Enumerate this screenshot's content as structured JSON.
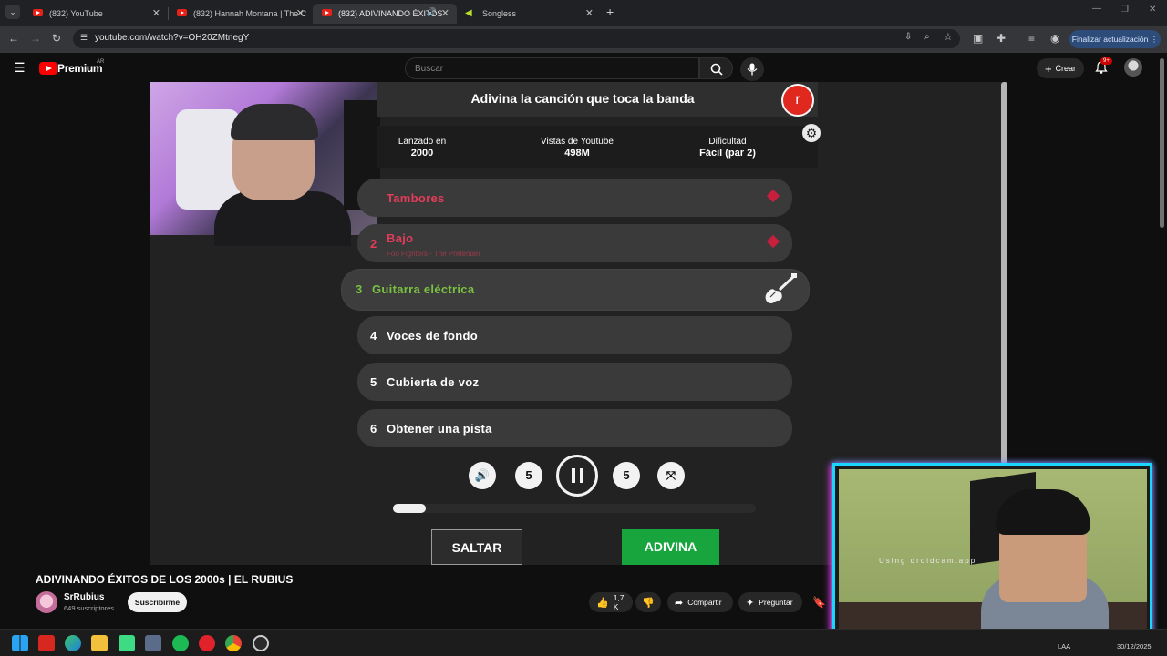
{
  "browser": {
    "tabs": [
      {
        "title": "(832) YouTube",
        "active": false
      },
      {
        "title": "(832) Hannah Montana | The C",
        "active": false
      },
      {
        "title": "(832) ADIVINANDO ÉXITOS",
        "active": true
      },
      {
        "title": "Songless",
        "active": false
      }
    ],
    "url": "youtube.com/watch?v=OH20ZMtnegY",
    "update_button": "Finalizar actualización"
  },
  "youtube": {
    "brand": "Premium",
    "region": "AR",
    "search_placeholder": "Buscar",
    "create_label": "Crear",
    "notification_badge": "9+"
  },
  "game": {
    "title": "Adivina la canción que toca la banda",
    "user_initial": "r",
    "stats": [
      {
        "label": "Lanzado en",
        "value": "2000"
      },
      {
        "label": "Vistas de Youtube",
        "value": "498M"
      },
      {
        "label": "Dificultad",
        "value": "Fácil (par 2)"
      }
    ],
    "tracks": [
      {
        "num": "",
        "label": "Tambores",
        "sub": "",
        "state": "failed"
      },
      {
        "num": "2",
        "label": "Bajo",
        "sub": "Foo Fighters - The Pretender",
        "state": "failed"
      },
      {
        "num": "3",
        "label": "Guitarra eléctrica",
        "sub": "",
        "state": "active"
      },
      {
        "num": "4",
        "label": "Voces de fondo",
        "sub": "",
        "state": "locked"
      },
      {
        "num": "5",
        "label": "Cubierta de voz",
        "sub": "",
        "state": "locked"
      },
      {
        "num": "6",
        "label": "Obtener una pista",
        "sub": "",
        "state": "locked"
      }
    ],
    "controls": {
      "rewind_seconds": "5",
      "forward_seconds": "5"
    },
    "progress": 0.09,
    "skip_label": "SALTAR",
    "guess_label": "ADIVINA"
  },
  "video": {
    "title": "ADIVINANDO ÉXITOS DE LOS 2000s | EL RUBIUS",
    "channel": "SrRubius",
    "subscribers": "649 suscriptores",
    "subscribe_label": "Suscribirme",
    "likes": "1,7 K",
    "share_label": "Compartir",
    "ask_label": "Preguntar"
  },
  "facecam": {
    "watermark": "Using droidcam.app"
  },
  "taskbar": {
    "lang": "LAA",
    "date": "30/12/2025"
  },
  "colors": {
    "accent_red": "#ff0000",
    "failed": "#e23c5a",
    "active": "#7ac142",
    "guess_green": "#19a53d",
    "frame": "#19d5ff"
  }
}
